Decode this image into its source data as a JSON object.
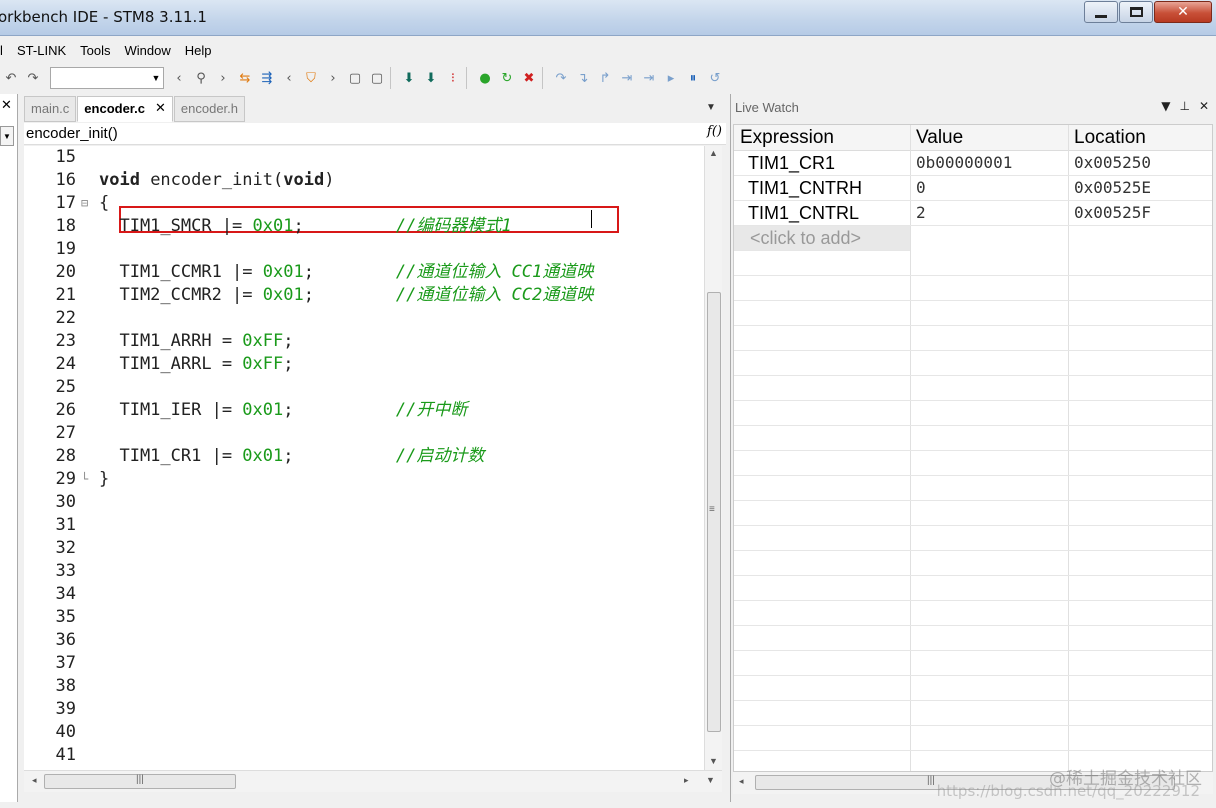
{
  "window": {
    "title": "orkbench IDE - STM8 3.11.1"
  },
  "menu": [
    "ST-LINK",
    "Tools",
    "Window",
    "Help"
  ],
  "editor": {
    "tabs": [
      {
        "label": "main.c",
        "active": false
      },
      {
        "label": "encoder.c",
        "active": true
      },
      {
        "label": "encoder.h",
        "active": false
      }
    ],
    "function_selector": "encoder_init()",
    "function_icon_label": "f()",
    "lines": [
      {
        "n": "15",
        "fold": "",
        "code": ""
      },
      {
        "n": "16",
        "fold": "",
        "code": "void encoder_init(void)"
      },
      {
        "n": "17",
        "fold": "⊟",
        "code": "{"
      },
      {
        "n": "18",
        "fold": "",
        "code": "  TIM1_SMCR |= 0x01;         //编码器模式1"
      },
      {
        "n": "19",
        "fold": "",
        "code": ""
      },
      {
        "n": "20",
        "fold": "",
        "code": "  TIM1_CCMR1 |= 0x01;        //通道位输入 CC1通道映"
      },
      {
        "n": "21",
        "fold": "",
        "code": "  TIM2_CCMR2 |= 0x01;        //通道位输入 CC2通道映"
      },
      {
        "n": "22",
        "fold": "",
        "code": ""
      },
      {
        "n": "23",
        "fold": "",
        "code": "  TIM1_ARRH = 0xFF;"
      },
      {
        "n": "24",
        "fold": "",
        "code": "  TIM1_ARRL = 0xFF;"
      },
      {
        "n": "25",
        "fold": "",
        "code": ""
      },
      {
        "n": "26",
        "fold": "",
        "code": "  TIM1_IER |= 0x01;          //开中断"
      },
      {
        "n": "27",
        "fold": "",
        "code": ""
      },
      {
        "n": "28",
        "fold": "",
        "code": "  TIM1_CR1 |= 0x01;          //启动计数"
      },
      {
        "n": "29",
        "fold": "└",
        "code": "}"
      },
      {
        "n": "30",
        "fold": "",
        "code": ""
      },
      {
        "n": "31",
        "fold": "",
        "code": ""
      },
      {
        "n": "32",
        "fold": "",
        "code": ""
      },
      {
        "n": "33",
        "fold": "",
        "code": ""
      },
      {
        "n": "34",
        "fold": "",
        "code": ""
      },
      {
        "n": "35",
        "fold": "",
        "code": ""
      },
      {
        "n": "36",
        "fold": "",
        "code": ""
      },
      {
        "n": "37",
        "fold": "",
        "code": ""
      },
      {
        "n": "38",
        "fold": "",
        "code": ""
      },
      {
        "n": "39",
        "fold": "",
        "code": ""
      },
      {
        "n": "40",
        "fold": "",
        "code": ""
      },
      {
        "n": "41",
        "fold": "",
        "code": ""
      }
    ]
  },
  "live_watch": {
    "title": "Live Watch",
    "columns": [
      "Expression",
      "Value",
      "Location"
    ],
    "rows": [
      {
        "expression": "TIM1_CR1",
        "value": "0b00000001",
        "location": "0x005250"
      },
      {
        "expression": "TIM1_CNTRH",
        "value": "0",
        "location": "0x00525E"
      },
      {
        "expression": "TIM1_CNTRL",
        "value": "2",
        "location": "0x00525F"
      }
    ],
    "add_placeholder": "<click to add>"
  },
  "watermark": {
    "line1": "@稀土掘金技术社区",
    "line2": "https://blog.csdn.net/qq_20222912"
  },
  "colors": {
    "highlight_box": "#d81818",
    "comment": "#1a9a1a",
    "number": "#1a9a1a"
  }
}
